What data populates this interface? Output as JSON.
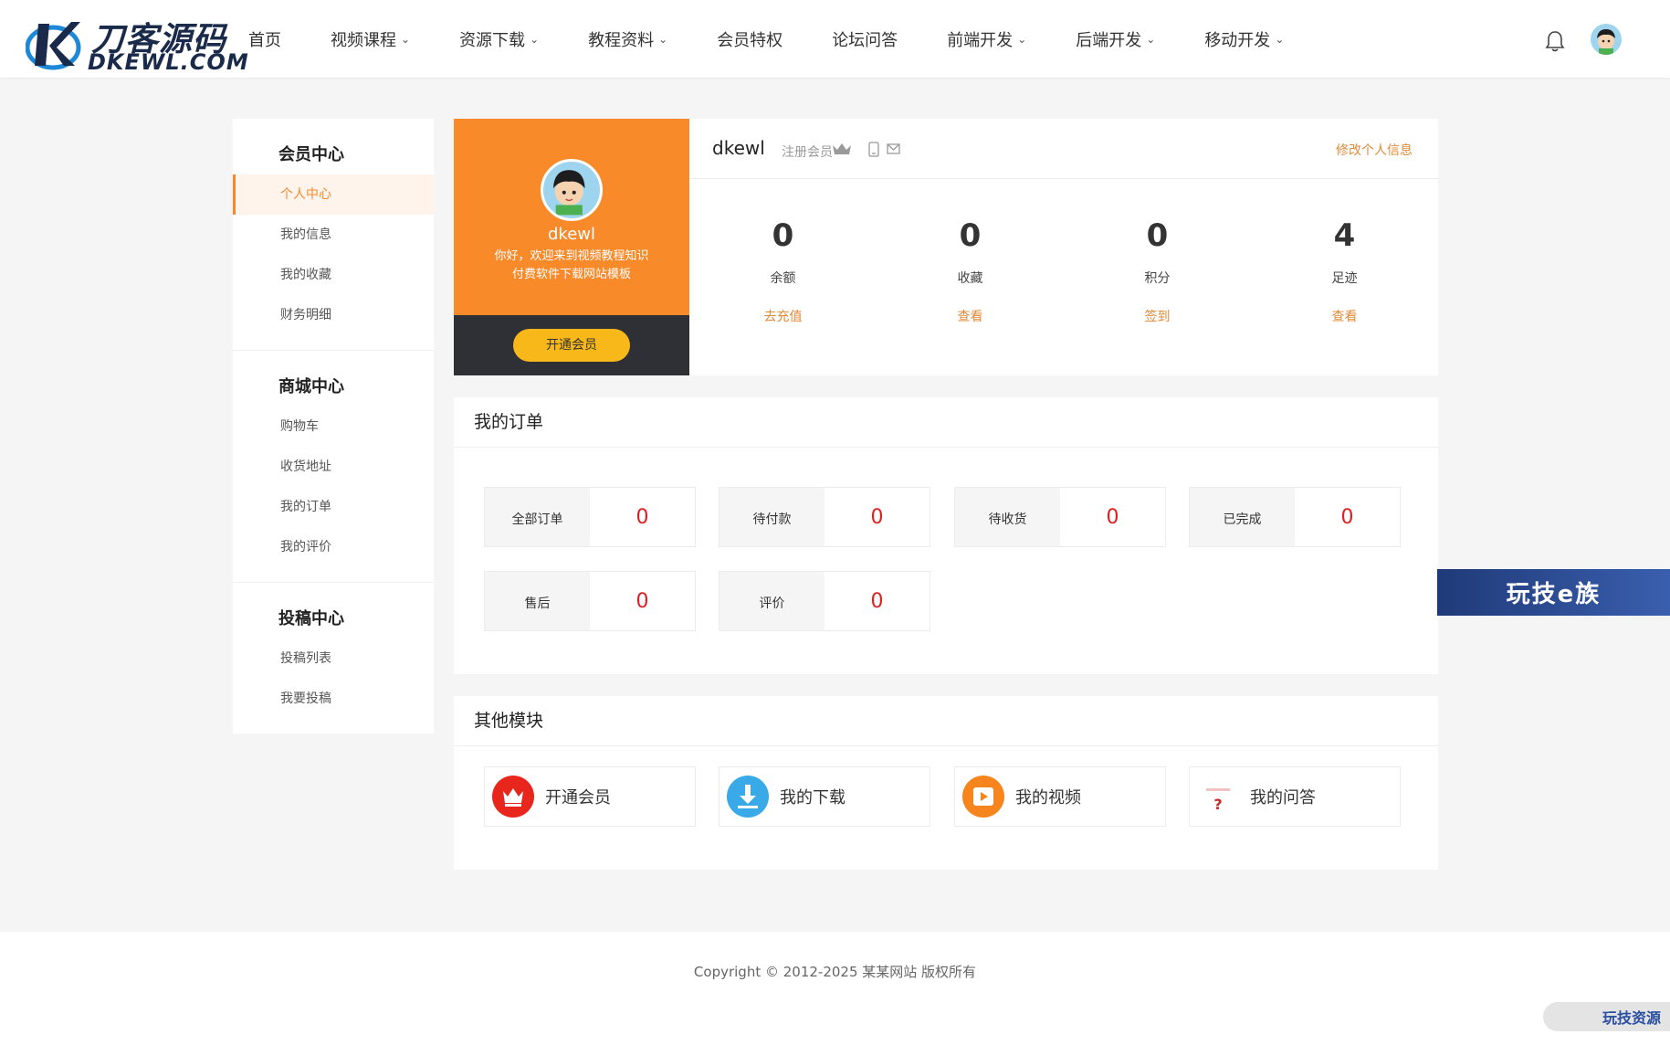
{
  "logo": {
    "cn": "刀客源码",
    "en": "DKEWL.COM"
  },
  "nav": [
    {
      "label": "首页",
      "dropdown": false
    },
    {
      "label": "视频课程",
      "dropdown": true
    },
    {
      "label": "资源下载",
      "dropdown": true
    },
    {
      "label": "教程资料",
      "dropdown": true
    },
    {
      "label": "会员特权",
      "dropdown": false
    },
    {
      "label": "论坛问答",
      "dropdown": false
    },
    {
      "label": "前端开发",
      "dropdown": true
    },
    {
      "label": "后端开发",
      "dropdown": true
    },
    {
      "label": "移动开发",
      "dropdown": true
    }
  ],
  "sidebar": {
    "groups": [
      {
        "title": "会员中心",
        "items": [
          "个人中心",
          "我的信息",
          "我的收藏",
          "财务明细"
        ]
      },
      {
        "title": "商城中心",
        "items": [
          "购物车",
          "收货地址",
          "我的订单",
          "我的评价"
        ]
      },
      {
        "title": "投稿中心",
        "items": [
          "投稿列表",
          "我要投稿"
        ]
      }
    ],
    "active_item": "个人中心"
  },
  "profile": {
    "name": "dkewl",
    "welcome_line1": "你好，欢迎来到视频教程知识",
    "welcome_line2": "付费软件下载网站模板",
    "vip_button": "开通会员",
    "username": "dkewl",
    "role": "注册会员",
    "edit_link": "修改个人信息",
    "stats": [
      {
        "value": "0",
        "label": "余额",
        "link": "去充值"
      },
      {
        "value": "0",
        "label": "收藏",
        "link": "查看"
      },
      {
        "value": "0",
        "label": "积分",
        "link": "签到"
      },
      {
        "value": "4",
        "label": "足迹",
        "link": "查看"
      }
    ]
  },
  "orders": {
    "title": "我的订单",
    "items": [
      {
        "label": "全部订单",
        "value": "0"
      },
      {
        "label": "待付款",
        "value": "0"
      },
      {
        "label": "待收货",
        "value": "0"
      },
      {
        "label": "已完成",
        "value": "0"
      },
      {
        "label": "售后",
        "value": "0"
      },
      {
        "label": "评价",
        "value": "0"
      }
    ]
  },
  "modules": {
    "title": "其他模块",
    "items": [
      {
        "label": "开通会员",
        "icon": "crown-icon",
        "color": "#e8261c"
      },
      {
        "label": "我的下载",
        "icon": "download-icon",
        "color": "#3aa9e8"
      },
      {
        "label": "我的视频",
        "icon": "play-icon",
        "color": "#f7851e"
      },
      {
        "label": "我的问答",
        "icon": "question-icon",
        "color": "#ffffff"
      }
    ]
  },
  "float_banner": "玩技e族",
  "footer": {
    "copyright": "Copyright © 2012-2025 某某网站 版权所有"
  },
  "corner_badge": "玩技资源",
  "colors": {
    "accent": "#f88a2a",
    "link": "#e08a3a",
    "order_value": "#e02020",
    "vip_button": "#f9b81a"
  }
}
